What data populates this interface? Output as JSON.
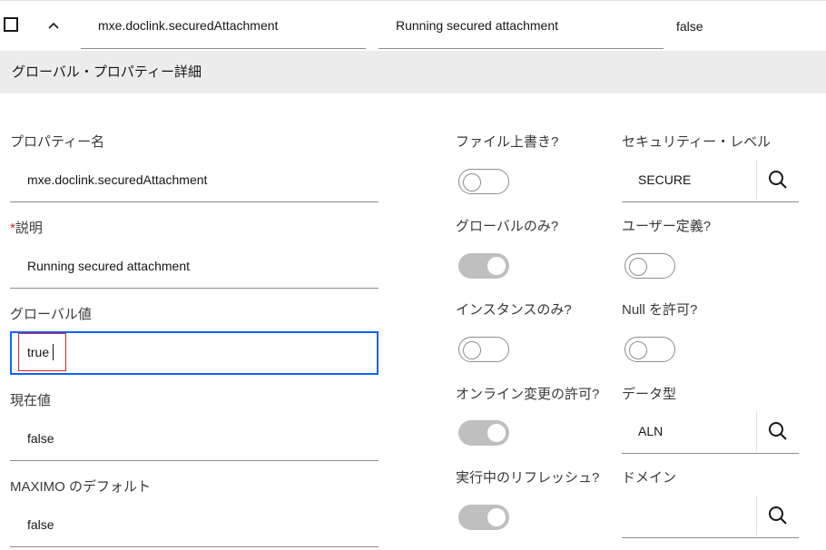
{
  "row": {
    "property_name": "mxe.doclink.securedAttachment",
    "description": "Running secured attachment",
    "current_value": "false"
  },
  "section": {
    "title": "グローバル・プロパティー詳細"
  },
  "form": {
    "property_name_label": "プロパティー名",
    "property_name_value": "mxe.doclink.securedAttachment",
    "required_marker": "*",
    "description_label": "説明",
    "description_value": "Running secured attachment",
    "global_value_label": "グローバル値",
    "global_value": "true",
    "current_value_label": "現在値",
    "current_value": "false",
    "maximo_default_label": "MAXIMO のデフォルト",
    "maximo_default_value": "false",
    "file_overwrite_label": "ファイル上書き?",
    "file_overwrite_on": false,
    "security_level_label": "セキュリティー・レベル",
    "security_level_value": "SECURE",
    "global_only_label": "グローバルのみ?",
    "global_only_on": true,
    "user_defined_label": "ユーザー定義?",
    "user_defined_on": false,
    "instance_only_label": "インスタンスのみ?",
    "instance_only_on": false,
    "null_allowed_label": "Null を許可?",
    "null_allowed_on": false,
    "online_change_label": "オンライン変更の許可?",
    "online_change_on": true,
    "data_type_label": "データ型",
    "data_type_value": "ALN",
    "live_refresh_label": "実行中のリフレッシュ?",
    "live_refresh_on": true,
    "domain_label": "ドメイン",
    "domain_value": ""
  },
  "icons": {
    "row_select": "checkbox-icon",
    "collapse": "chevron-up-icon",
    "lookup": "search-icon"
  }
}
